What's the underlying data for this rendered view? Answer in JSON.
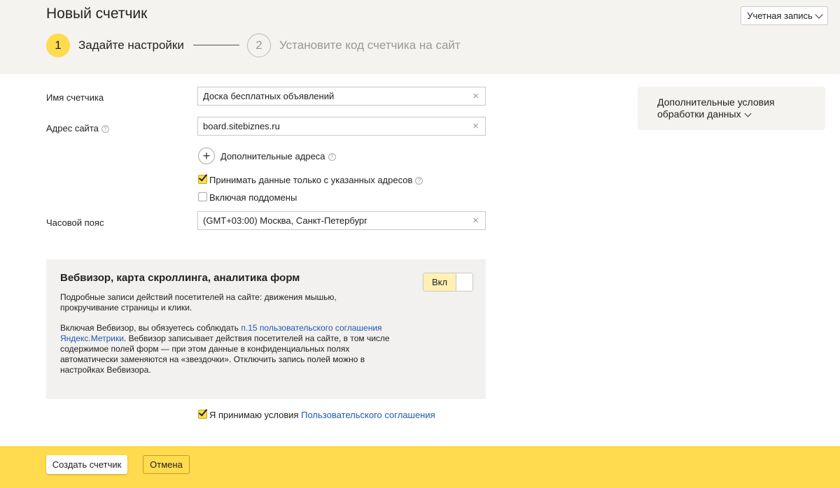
{
  "header": {
    "title": "Новый счетчик",
    "account_button": "Учетная запись",
    "steps": [
      {
        "number": "1",
        "label": "Задайте настройки"
      },
      {
        "number": "2",
        "label": "Установите код счетчика на сайт"
      }
    ]
  },
  "form": {
    "counter_name": {
      "label": "Имя счетчика",
      "value": "Доска бесплатных объявлений"
    },
    "site_address": {
      "label": "Адрес сайта",
      "value": "board.sitebiznes.ru"
    },
    "additional_addresses": {
      "label": "Дополнительные адреса"
    },
    "only_specified": {
      "label": "Принимать данные только с указанных адресов",
      "checked": true
    },
    "include_subdomains": {
      "label": "Включая поддомены",
      "checked": false
    },
    "timezone": {
      "label": "Часовой пояс",
      "value": "(GMT+03:00) Москва, Санкт-Петербург"
    }
  },
  "side_panel": {
    "line1": "Дополнительные условия",
    "line2": "обработки данных"
  },
  "webvisor": {
    "title": "Вебвизор, карта скроллинга, аналитика форм",
    "description": "Подробные записи действий посетителей на сайте: движения мышью, прокручивание страницы и клики.",
    "terms_prefix": "Включая Вебвизор, вы обязуетесь соблюдать ",
    "terms_link": "п.15 пользовательского соглашения Яндекс.Метрики",
    "terms_suffix": ". Вебвизор записывает действия посетителей на сайте, в том числе содержимое полей форм — при этом данные в конфиденциальных полях автоматически заменяются на «звездочки». Отключить запись полей можно в настройках Вебвизора.",
    "toggle_label": "Вкл",
    "enabled": true
  },
  "agreement": {
    "prefix": "Я принимаю условия ",
    "link": "Пользовательского соглашения",
    "checked": true
  },
  "footer": {
    "create_button": "Создать счетчик",
    "cancel_button": "Отмена"
  },
  "colors": {
    "accent_yellow": "#ffdb4d",
    "link_blue": "#1f58b5",
    "header_bg": "#f4f3ef"
  }
}
